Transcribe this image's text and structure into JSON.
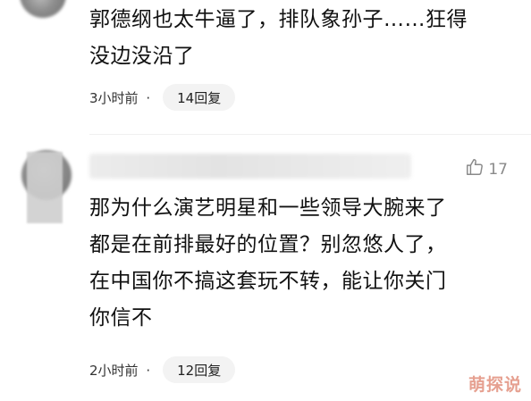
{
  "comments": [
    {
      "text_lines": [
        "郭德纲也太牛逼了，排队象孙子……狂得",
        "没边没沿了"
      ],
      "time": "3小时前",
      "separator": "·",
      "replies": "14回复"
    },
    {
      "likes": "17",
      "text_lines": [
        "那为什么演艺明星和一些领导大腕来了",
        "都是在前排最好的位置？别忽悠人了，",
        "在中国你不搞这套玩不转，能让你关门",
        "你信不"
      ],
      "time": "2小时前",
      "separator": "·",
      "replies": "12回复"
    }
  ],
  "watermark": "萌探说",
  "colors": {
    "reply_pill_bg": "#f3f3f3",
    "watermark": "#e6a090",
    "like_gray": "#8a8a8a"
  },
  "icons": {
    "like": "thumbs-up-icon"
  }
}
